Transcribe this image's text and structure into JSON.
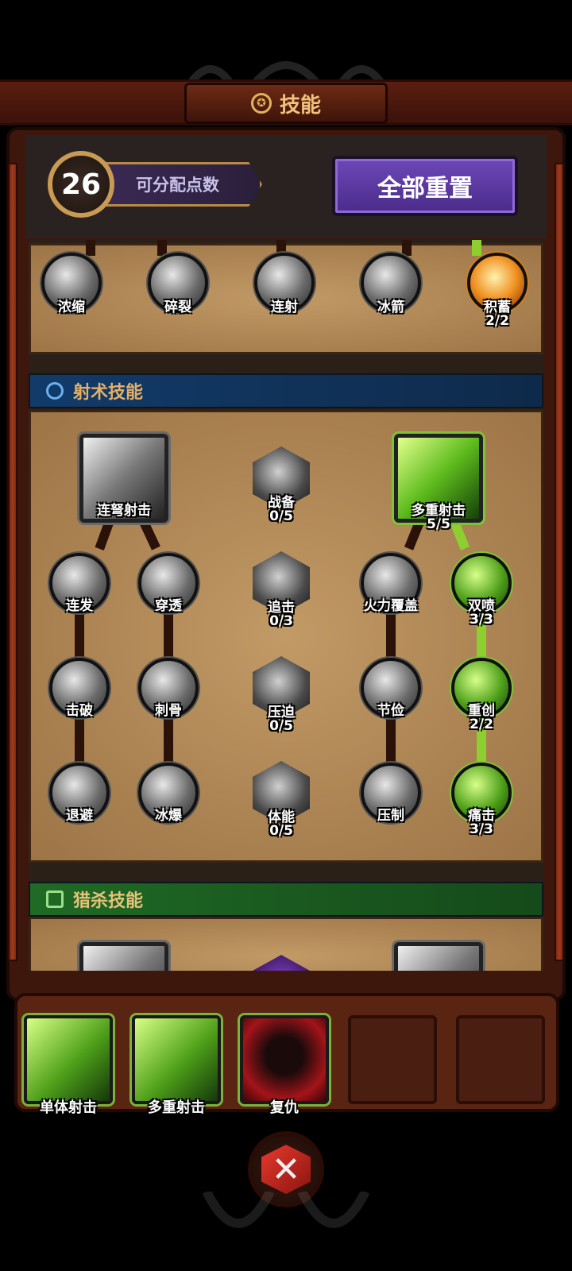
{
  "header": {
    "title": "技能",
    "title_icon": "pentagram-icon"
  },
  "points": {
    "value": "26",
    "label": "可分配点数"
  },
  "reset_button": {
    "label": "全部重置",
    "color": "#5a38a0"
  },
  "top_row": [
    {
      "name": "浓缩"
    },
    {
      "name": "碎裂"
    },
    {
      "name": "连射"
    },
    {
      "name": "冰箭"
    },
    {
      "name": "积蓄",
      "count": "2/2"
    }
  ],
  "sections": {
    "shooting": {
      "title": "射术技能",
      "color": "#123b6a"
    },
    "hunting": {
      "title": "猎杀技能",
      "color": "#1f6a25"
    }
  },
  "shooting_skills": {
    "left_root": {
      "name": "连弩射击"
    },
    "mid_1": {
      "name": "战备",
      "count": "0/5"
    },
    "right_root": {
      "name": "多重射击",
      "count": "5/5"
    },
    "row2": [
      {
        "name": "连发"
      },
      {
        "name": "穿透"
      },
      {
        "name": "追击",
        "count": "0/3"
      },
      {
        "name": "火力覆盖"
      },
      {
        "name": "双喷",
        "count": "3/3"
      }
    ],
    "row3": [
      {
        "name": "击破"
      },
      {
        "name": "刺骨"
      },
      {
        "name": "压迫",
        "count": "0/5"
      },
      {
        "name": "节俭"
      },
      {
        "name": "重创",
        "count": "2/2"
      }
    ],
    "row4": [
      {
        "name": "退避"
      },
      {
        "name": "冰爆"
      },
      {
        "name": "体能",
        "count": "0/5"
      },
      {
        "name": "压制"
      },
      {
        "name": "痛击",
        "count": "3/3"
      }
    ]
  },
  "equipped": [
    {
      "name": "单体射击"
    },
    {
      "name": "多重射击"
    },
    {
      "name": "复仇"
    },
    {
      "name": ""
    },
    {
      "name": ""
    }
  ],
  "battle_button": {
    "icon": "crossed-swords-icon"
  }
}
